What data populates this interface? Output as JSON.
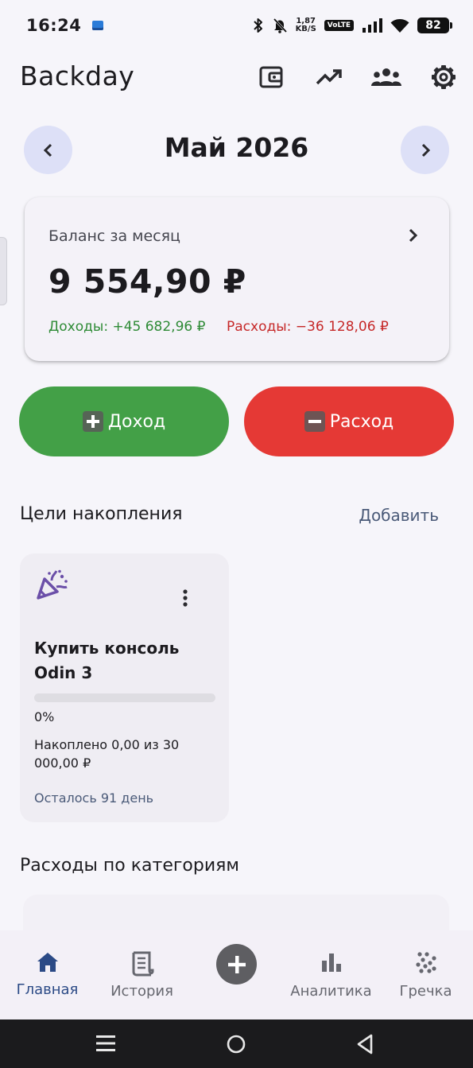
{
  "status_bar": {
    "time": "16:24",
    "speed_value": "1,87",
    "speed_unit": "KB/S",
    "volte": "VoLTE",
    "battery": "82",
    "icons": [
      "app-notification-icon",
      "bluetooth-icon",
      "bell-off-icon",
      "signal-icon",
      "wifi-icon",
      "battery-icon"
    ]
  },
  "app_bar": {
    "title": "Backday",
    "actions": [
      "wallet-icon",
      "trending-up-icon",
      "group-icon",
      "settings-icon"
    ]
  },
  "month_nav": {
    "title": "Май 2026",
    "prev_icon": "chevron-left-icon",
    "next_icon": "chevron-right-icon"
  },
  "balance": {
    "label": "Баланс за месяц",
    "value": "9 554,90 ₽",
    "income": "Доходы: +45 682,96 ₽",
    "expense": "Расходы: −36 128,06 ₽"
  },
  "actions": {
    "income_label": "Доход",
    "expense_label": "Расход"
  },
  "goals": {
    "section_title": "Цели накопления",
    "add_label": "Добавить",
    "items": [
      {
        "icon": "party-popper-icon",
        "title": "Купить консоль Odin 3",
        "progress": 0,
        "percent_label": "0%",
        "saved_label": "Накоплено 0,00 из 30 000,00 ₽",
        "remaining_label": "Осталось 91 день"
      }
    ]
  },
  "categories": {
    "section_title": "Расходы по категориям"
  },
  "bottom_nav": {
    "items": [
      {
        "label": "Главная",
        "icon": "home-icon",
        "active": true
      },
      {
        "label": "История",
        "icon": "receipt-icon",
        "active": false
      },
      {
        "label": "",
        "icon": "add-circle-icon",
        "active": false
      },
      {
        "label": "Аналитика",
        "icon": "bar-chart-icon",
        "active": false
      },
      {
        "label": "Гречка",
        "icon": "grain-icon",
        "active": false
      }
    ]
  },
  "colors": {
    "income": "#43a047",
    "expense": "#e53935",
    "income_text": "#2e8b36",
    "expense_text": "#c62828",
    "accent": "#6b5aa8",
    "nav_active": "#2b4a86"
  }
}
